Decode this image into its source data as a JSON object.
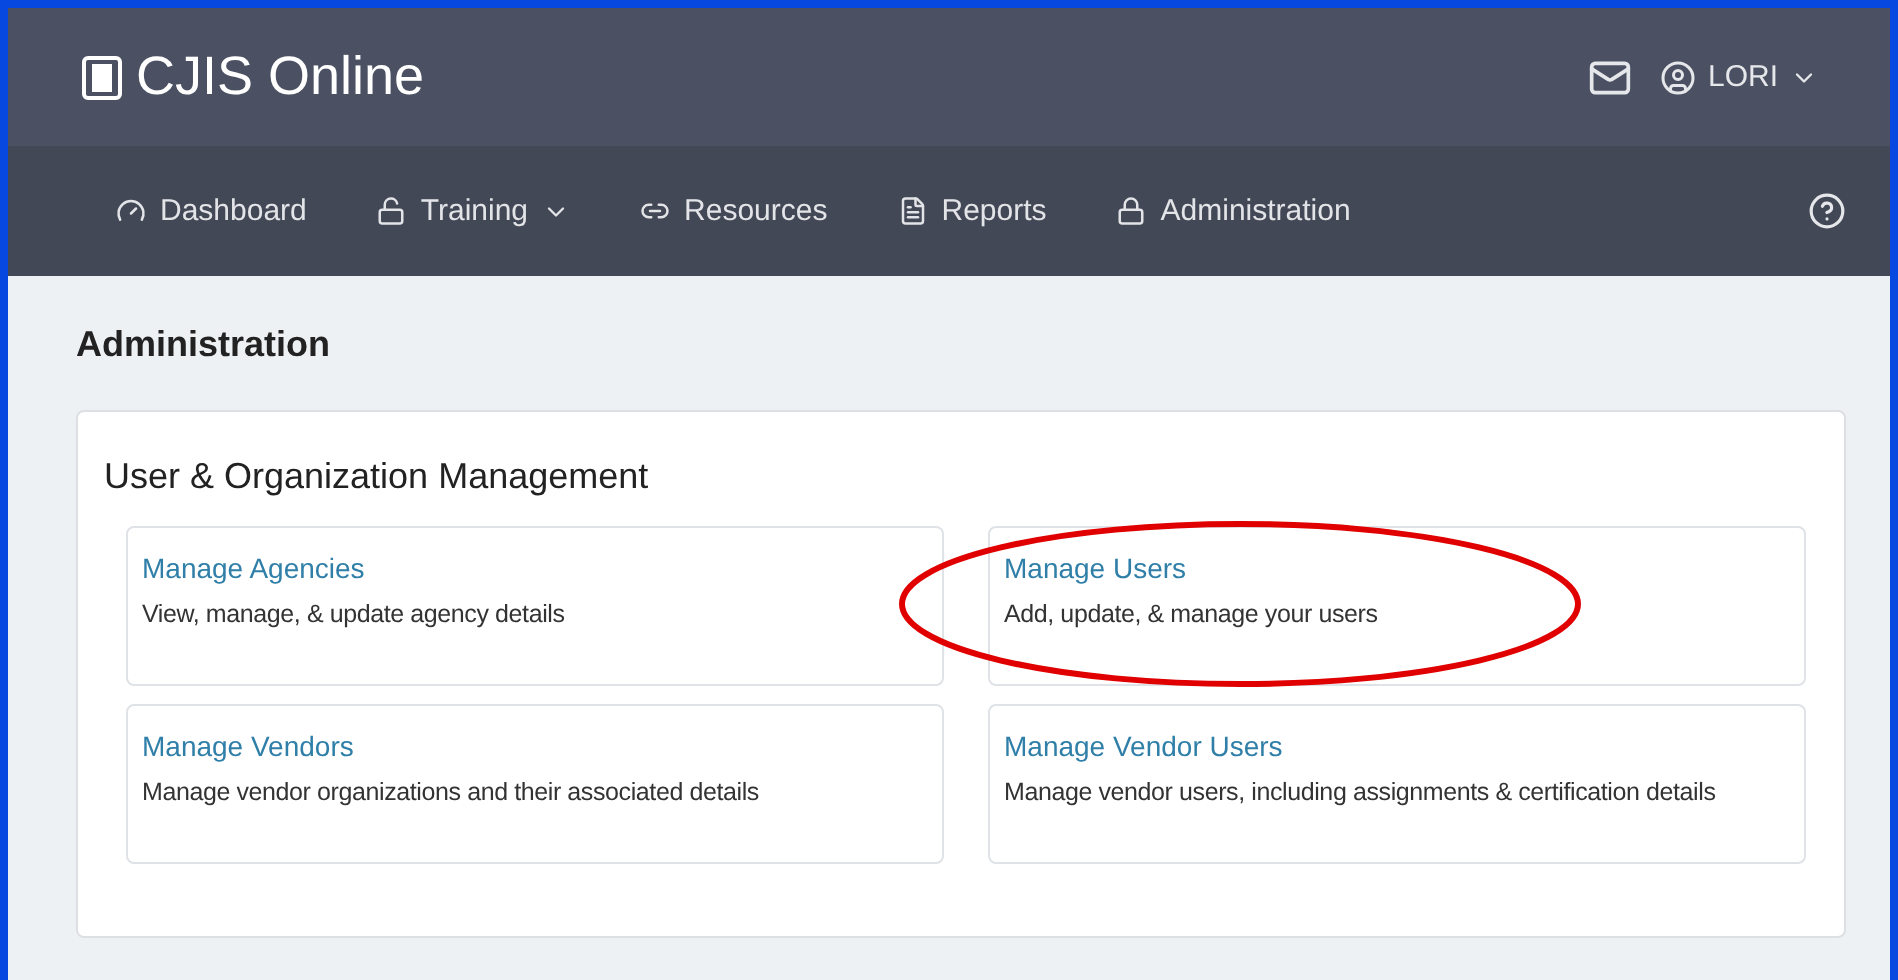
{
  "header": {
    "brand": "CJIS Online",
    "user": "LORI"
  },
  "nav": [
    {
      "label": "Dashboard",
      "dropdown": false
    },
    {
      "label": "Training",
      "dropdown": true
    },
    {
      "label": "Resources",
      "dropdown": false
    },
    {
      "label": "Reports",
      "dropdown": false
    },
    {
      "label": "Administration",
      "dropdown": false
    }
  ],
  "page_title": "Administration",
  "section": {
    "title": "User & Organization Management",
    "tiles": [
      {
        "title": "Manage Agencies",
        "description": "View, manage, & update agency details",
        "circled": false
      },
      {
        "title": "Manage Users",
        "description": "Add, update, & manage your users",
        "circled": true
      },
      {
        "title": "Manage Vendors",
        "description": "Manage vendor organizations and their associated details",
        "circled": false
      },
      {
        "title": "Manage Vendor Users",
        "description": "Manage vendor users, including assignments & certification details",
        "circled": false
      }
    ]
  }
}
